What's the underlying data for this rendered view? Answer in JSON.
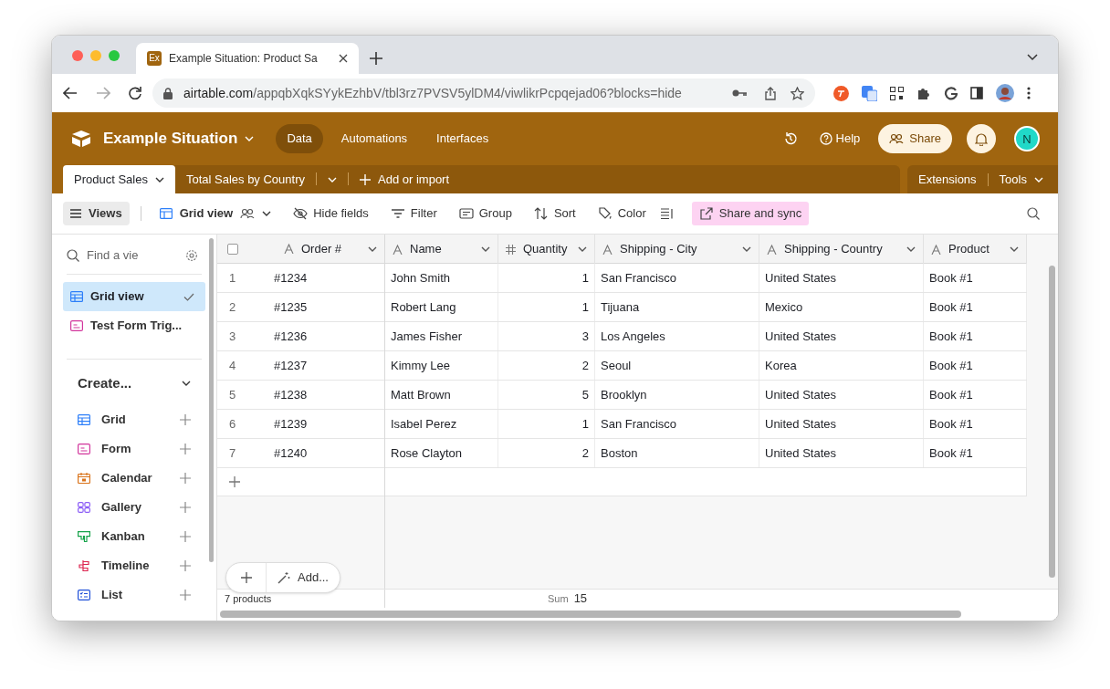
{
  "browser": {
    "tab_title": "Example Situation: Product Sa",
    "favicon": "Ex",
    "url_host": "airtable.com",
    "url_path": "/appqbXqkSYykEzhbV/tbl3rz7PVSV5ylDM4/viwlikrPcpqejad06?blocks=hide"
  },
  "header": {
    "base_name": "Example Situation",
    "nav": [
      {
        "label": "Data",
        "selected": true
      },
      {
        "label": "Automations",
        "selected": false
      },
      {
        "label": "Interfaces",
        "selected": false
      }
    ],
    "help": "Help",
    "share": "Share",
    "avatar": "N"
  },
  "tables": [
    {
      "label": "Product Sales",
      "selected": true
    },
    {
      "label": "Total Sales by Country",
      "selected": false
    }
  ],
  "add_table": "Add or import",
  "extensions": "Extensions",
  "tools": "Tools",
  "toolbar": {
    "views": "Views",
    "view_name": "Grid view",
    "items": [
      {
        "label": "Hide fields",
        "kind": "hide"
      },
      {
        "label": "Filter",
        "kind": "filter"
      },
      {
        "label": "Group",
        "kind": "group"
      },
      {
        "label": "Sort",
        "kind": "sort"
      },
      {
        "label": "Color",
        "kind": "color"
      },
      {
        "label": "Share and sync",
        "kind": "share"
      }
    ]
  },
  "sidebar": {
    "search_placeholder": "Find a vie",
    "views": [
      {
        "label": "Grid view",
        "kind": "grid",
        "selected": true
      },
      {
        "label": "Test Form Trig...",
        "kind": "form",
        "selected": false
      }
    ],
    "create_label": "Create...",
    "create_items": [
      {
        "label": "Grid",
        "kind": "grid"
      },
      {
        "label": "Form",
        "kind": "form"
      },
      {
        "label": "Calendar",
        "kind": "calendar"
      },
      {
        "label": "Gallery",
        "kind": "gallery"
      },
      {
        "label": "Kanban",
        "kind": "kanban"
      },
      {
        "label": "Timeline",
        "kind": "timeline"
      },
      {
        "label": "List",
        "kind": "list"
      }
    ]
  },
  "table": {
    "select_all": {
      "checked": false
    },
    "columns": [
      {
        "label": "Order #",
        "kind": "text"
      },
      {
        "label": "Name",
        "kind": "text"
      },
      {
        "label": "Quantity",
        "kind": "number"
      },
      {
        "label": "Shipping - City",
        "kind": "text"
      },
      {
        "label": "Shipping - Country",
        "kind": "text"
      },
      {
        "label": "Product",
        "kind": "text"
      }
    ],
    "rows": [
      {
        "number": "1",
        "cells": [
          "#1234",
          "John Smith",
          "1",
          "San Francisco",
          "United States",
          "Book #1"
        ]
      },
      {
        "number": "2",
        "cells": [
          "#1235",
          "Robert Lang",
          "1",
          "Tijuana",
          "Mexico",
          "Book #1"
        ]
      },
      {
        "number": "3",
        "cells": [
          "#1236",
          "James Fisher",
          "3",
          "Los Angeles",
          "United States",
          "Book #1"
        ]
      },
      {
        "number": "4",
        "cells": [
          "#1237",
          "Kimmy Lee",
          "2",
          "Seoul",
          "Korea",
          "Book #1"
        ]
      },
      {
        "number": "5",
        "cells": [
          "#1238",
          "Matt Brown",
          "5",
          "Brooklyn",
          "United States",
          "Book #1"
        ]
      },
      {
        "number": "6",
        "cells": [
          "#1239",
          "Isabel Perez",
          "1",
          "San Francisco",
          "United States",
          "Book #1"
        ]
      },
      {
        "number": "7",
        "cells": [
          "#1240",
          "Rose Clayton",
          "2",
          "Boston",
          "United States",
          "Book #1"
        ]
      }
    ],
    "record_count": "7 products",
    "sum_label": "Sum",
    "sum_value": "15",
    "add_label": "Add..."
  }
}
